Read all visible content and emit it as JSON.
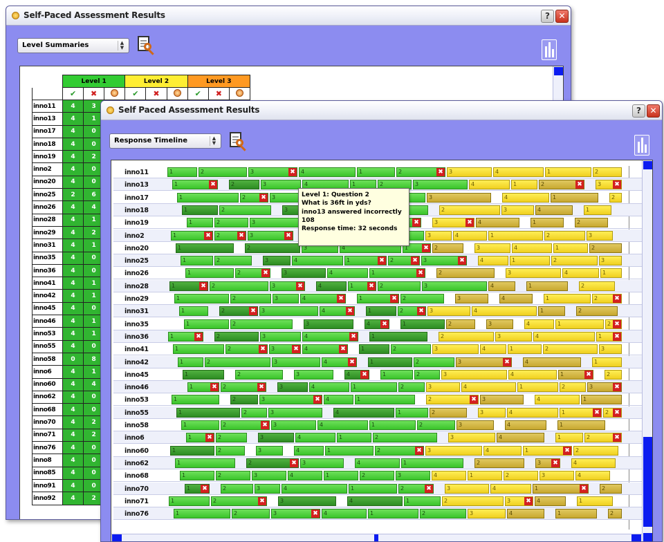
{
  "back_window": {
    "title": "Self-Paced Assessment Results",
    "view_select": "Level Summaries",
    "levels": [
      {
        "label": "Level 1",
        "color": "#33cc33"
      },
      {
        "label": "Level 2",
        "color": "#ffee33"
      },
      {
        "label": "Level 3",
        "color": "#ff9922"
      }
    ],
    "column_icons": [
      "check-icon",
      "x-icon",
      "clock-icon",
      "check-icon",
      "x-icon",
      "clock-icon",
      "check-icon",
      "x-icon",
      "clock-icon"
    ],
    "rows": [
      {
        "name": "inno11",
        "v": [
          "4",
          "3"
        ]
      },
      {
        "name": "inno13",
        "v": [
          "4",
          "1"
        ]
      },
      {
        "name": "inno17",
        "v": [
          "4",
          "0"
        ]
      },
      {
        "name": "inno18",
        "v": [
          "4",
          "0"
        ]
      },
      {
        "name": "inno19",
        "v": [
          "4",
          "2"
        ]
      },
      {
        "name": "inno2",
        "v": [
          "4",
          "0"
        ]
      },
      {
        "name": "inno20",
        "v": [
          "4",
          "0"
        ]
      },
      {
        "name": "inno25",
        "v": [
          "2",
          "6"
        ]
      },
      {
        "name": "inno26",
        "v": [
          "4",
          "4"
        ]
      },
      {
        "name": "inno28",
        "v": [
          "4",
          "1"
        ]
      },
      {
        "name": "inno29",
        "v": [
          "4",
          "2"
        ]
      },
      {
        "name": "inno31",
        "v": [
          "4",
          "1"
        ]
      },
      {
        "name": "inno35",
        "v": [
          "4",
          "0"
        ]
      },
      {
        "name": "inno36",
        "v": [
          "4",
          "0"
        ]
      },
      {
        "name": "inno41",
        "v": [
          "4",
          "1"
        ]
      },
      {
        "name": "inno42",
        "v": [
          "4",
          "1"
        ]
      },
      {
        "name": "inno45",
        "v": [
          "4",
          "0"
        ]
      },
      {
        "name": "inno46",
        "v": [
          "4",
          "1"
        ]
      },
      {
        "name": "inno53",
        "v": [
          "4",
          "1"
        ]
      },
      {
        "name": "inno55",
        "v": [
          "4",
          "0"
        ]
      },
      {
        "name": "inno58",
        "v": [
          "0",
          "8"
        ]
      },
      {
        "name": "inno6",
        "v": [
          "4",
          "1"
        ]
      },
      {
        "name": "inno60",
        "v": [
          "4",
          "4"
        ]
      },
      {
        "name": "inno62",
        "v": [
          "4",
          "0"
        ]
      },
      {
        "name": "inno68",
        "v": [
          "4",
          "0"
        ]
      },
      {
        "name": "inno70",
        "v": [
          "4",
          "2"
        ]
      },
      {
        "name": "inno71",
        "v": [
          "4",
          "2"
        ]
      },
      {
        "name": "inno76",
        "v": [
          "4",
          "0"
        ]
      },
      {
        "name": "inno8",
        "v": [
          "4",
          "0"
        ]
      },
      {
        "name": "inno85",
        "v": [
          "4",
          "0"
        ]
      },
      {
        "name": "inno91",
        "v": [
          "4",
          "0"
        ]
      },
      {
        "name": "inno92",
        "v": [
          "4",
          "2"
        ]
      }
    ]
  },
  "front_window": {
    "title": "Self Paced Assessment Results",
    "view_select": "Response Timeline",
    "tooltip": {
      "line1": "Level 1: Question 2",
      "line2": "What is 36ft in yds?",
      "line3": "inno13 answered incorrectly",
      "line4": "108",
      "line5": "Response time: 32 seconds"
    },
    "rows": [
      {
        "name": "inno11"
      },
      {
        "name": "inno13"
      },
      {
        "name": "inno17"
      },
      {
        "name": "inno18"
      },
      {
        "name": "inno19"
      },
      {
        "name": "inno2"
      },
      {
        "name": "inno20"
      },
      {
        "name": "inno25"
      },
      {
        "name": "inno26"
      },
      {
        "name": "inno28"
      },
      {
        "name": "inno29"
      },
      {
        "name": "inno31"
      },
      {
        "name": "inno35"
      },
      {
        "name": "inno36"
      },
      {
        "name": "inno41"
      },
      {
        "name": "inno42"
      },
      {
        "name": "inno45"
      },
      {
        "name": "inno46"
      },
      {
        "name": "inno53"
      },
      {
        "name": "inno55"
      },
      {
        "name": "inno58"
      },
      {
        "name": "inno6"
      },
      {
        "name": "inno60"
      },
      {
        "name": "inno62"
      },
      {
        "name": "inno68"
      },
      {
        "name": "inno70"
      },
      {
        "name": "inno71"
      },
      {
        "name": "inno76"
      }
    ]
  }
}
